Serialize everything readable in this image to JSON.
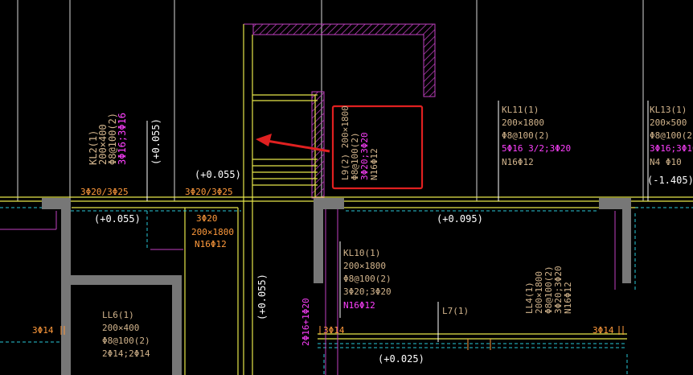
{
  "colors": {
    "background": "#000000",
    "grid_line": "#d8d8d8",
    "beam_yellow": "#e6e64a",
    "column_gray": "#777777",
    "text_tan": "#d2b48c",
    "text_white": "#ffffff",
    "text_magenta": "#ff40ff",
    "text_orange": "#ff9a3c",
    "hatch_magenta": "#c040c0",
    "cyan_dash": "#28c8d8",
    "red_marker": "#e02020"
  },
  "annotations": {
    "kl2": {
      "name": "KL2(1)",
      "size": "200×400",
      "stirrup": "Φ8@100(2)",
      "rebar": "3Φ16;3Φ16"
    },
    "kl2_elev": "(+0.055)",
    "elev_left": "(+0.055)",
    "elev_mid": "(+0.055)",
    "rebar_3phi20_3phi25_a": "3Φ20/3Φ25",
    "rebar_3phi20_3phi25_b": "3Φ20/3Φ25",
    "beam_under": {
      "rebar": "3Φ20",
      "size": "200×1800",
      "side": "N16Φ12"
    },
    "l9": {
      "name": "L9(2) 200×1800",
      "stirrup": "Φ8@100(2)",
      "rebar": "3Φ20;3Φ20",
      "side": "N16Φ12"
    },
    "kl11": {
      "name": "KL11(1)",
      "size": "200×1800",
      "stirrup": "Φ8@100(2)",
      "rebar": "5Φ16 3/2;3Φ20",
      "side": "N16Φ12"
    },
    "kl13": {
      "name": "KL13(1)",
      "size": "200×500",
      "stirrup": "Φ8@100(2)",
      "rebar": "3Φ16;3Φ16",
      "side": "N4 Φ10",
      "elev": "(-1.405)"
    },
    "elev_right": "(+0.095)",
    "kl10": {
      "name": "KL10(1)",
      "size": "200×1800",
      "stirrup": "Φ8@100(2)",
      "rebar": "3Φ20;3Φ20",
      "side": "N16Φ12"
    },
    "l7": "L7(1)",
    "ll4": {
      "name": "LL4(1)",
      "size": "200×1800",
      "stirrup": "Φ8@100(2)",
      "rebar": "3Φ20;3Φ20",
      "side": "N16Φ12"
    },
    "ll6": {
      "name": "LL6(1)",
      "size": "200×400",
      "stirrup": "Φ8@100(2)",
      "rebar": "2Φ14;2Φ14"
    },
    "elev_vertical": "(+0.055)",
    "elev_bottom": "(+0.025)",
    "rebar_3phi14_left": "3Φ14",
    "rebar_3phi14_mid": "3Φ14",
    "rebar_3phi14_right": "3Φ14",
    "rebar_vertical_magenta": "2Φ16+1Φ20"
  }
}
